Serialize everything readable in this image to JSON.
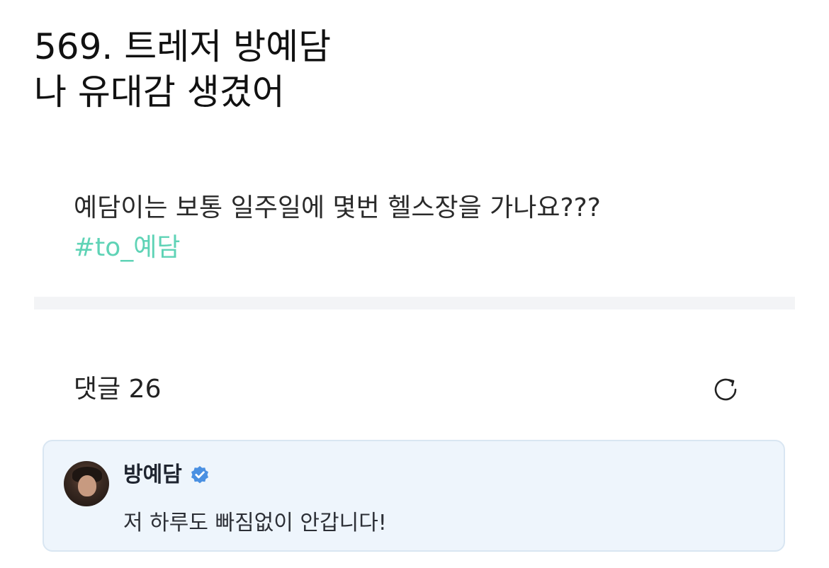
{
  "headline": {
    "line1": "569. 트레저 방예담",
    "line2": "나 유대감 생겼어"
  },
  "post": {
    "question": "예담이는 보통 일주일에 몇번 헬스장을 가나요???",
    "hashtag": "#to_예담"
  },
  "comments": {
    "count_label": "댓글 26",
    "refresh_icon": "refresh-icon",
    "items": [
      {
        "author": "방예담",
        "verified": true,
        "text": "저 하루도 빠짐없이 안갑니다!"
      }
    ]
  },
  "colors": {
    "hashtag": "#5fd3b6",
    "card_background": "#eef5fc",
    "card_border": "#d9e6f2",
    "verified_badge": "#4a90e2",
    "divider": "#f3f4f6"
  }
}
